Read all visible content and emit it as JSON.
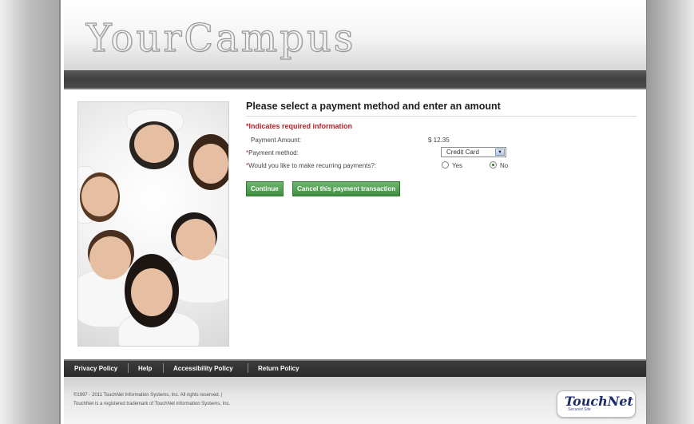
{
  "header": {
    "logo_text": "YourCampus"
  },
  "main": {
    "heading": "Please select a payment method and enter an amount",
    "required_note": "Indicates required information",
    "required_marker": "*",
    "payment_amount": {
      "label": "Payment Amount:",
      "value": "$ 12.35"
    },
    "payment_method": {
      "label": "Payment method:",
      "selected": "Credit Card"
    },
    "recurring": {
      "label": "Would you like to make recurring payments?:",
      "options": [
        "Yes",
        "No"
      ],
      "selected": "No"
    },
    "buttons": {
      "continue": "Continue",
      "cancel": "Cancel this payment transaction"
    }
  },
  "footer": {
    "links": [
      "Privacy Policy",
      "Help",
      "Accessibility Policy",
      "Return Policy"
    ],
    "copyright_line1": "©1997 - 2011 TouchNet Information Systems, Inc. All rights reserved. |",
    "copyright_line2": "TouchNet is a registered trademark of TouchNet Information Systems, Inc.",
    "brand": {
      "name": "TouchNet",
      "tagline": "Secured Site"
    }
  },
  "colors": {
    "required_red": "#b1242a",
    "button_green": "#4f9f4f",
    "brand_navy": "#1b2c6d"
  }
}
